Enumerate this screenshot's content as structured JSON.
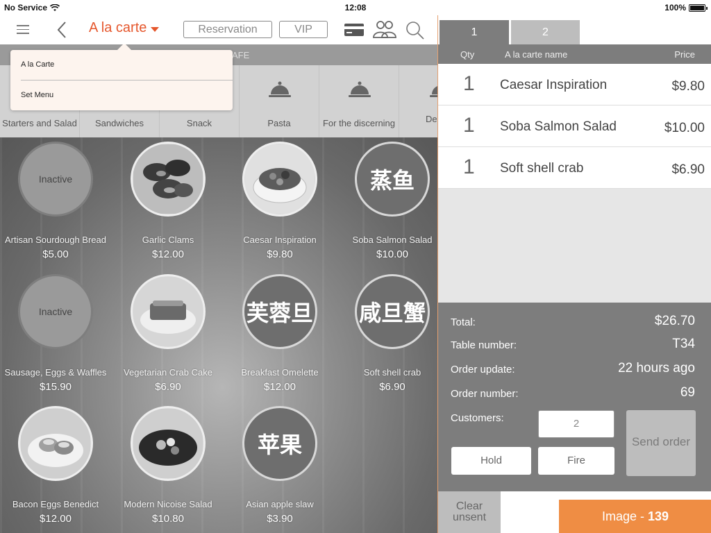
{
  "status": {
    "carrier": "No Service",
    "time": "12:08",
    "battery": "100%"
  },
  "nav": {
    "menu_title": "A la carte",
    "reservation": "Reservation",
    "vip": "VIP"
  },
  "dropdown": {
    "items": [
      "A la Carte",
      "Set Menu"
    ]
  },
  "subcategory_label": "AFE",
  "categories": [
    "Starters and Salad",
    "Sandwiches",
    "Snack",
    "Pasta",
    "For the discerning",
    "De"
  ],
  "dishes": [
    {
      "name": "Artisan Sourdough Bread",
      "price": "$5.00",
      "state": "Inactive"
    },
    {
      "name": "Garlic Clams",
      "price": "$12.00"
    },
    {
      "name": "Caesar Inspiration",
      "price": "$9.80"
    },
    {
      "name": "Soba Salmon Salad",
      "price": "$10.00",
      "cn": "蒸鱼"
    },
    {
      "name": "Sausage, Eggs & Waffles",
      "price": "$15.90",
      "state": "Inactive"
    },
    {
      "name": "Vegetarian Crab Cake",
      "price": "$6.90"
    },
    {
      "name": "Breakfast Omelette",
      "price": "$12.00",
      "cn": "芙蓉旦"
    },
    {
      "name": "Soft shell crab",
      "price": "$6.90",
      "cn": "咸旦蟹"
    },
    {
      "name": "Bacon Eggs Benedict",
      "price": "$12.00"
    },
    {
      "name": "Modern Nicoise Salad",
      "price": "$10.80"
    },
    {
      "name": "Asian apple slaw",
      "price": "$3.90",
      "cn": "苹果"
    }
  ],
  "tabs": [
    "1",
    "2"
  ],
  "order_header": {
    "qty": "Qty",
    "name": "A la carte name",
    "price": "Price"
  },
  "order_items": [
    {
      "qty": "1",
      "name": "Caesar Inspiration",
      "price": "$9.80"
    },
    {
      "qty": "1",
      "name": "Soba Salmon Salad",
      "price": "$10.00"
    },
    {
      "qty": "1",
      "name": "Soft shell crab",
      "price": "$6.90"
    }
  ],
  "summary": {
    "total_label": "Total:",
    "total": "$26.70",
    "table_label": "Table number:",
    "table": "T34",
    "update_label": "Order update:",
    "update": "22 hours ago",
    "order_label": "Order number:",
    "order": "69",
    "customers_label": "Customers:",
    "customers": "2"
  },
  "buttons": {
    "send": "Send order",
    "hold": "Hold",
    "fire": "Fire",
    "clear": "Clear unsent"
  },
  "badge": {
    "prefix": "Image - ",
    "number": "139"
  }
}
